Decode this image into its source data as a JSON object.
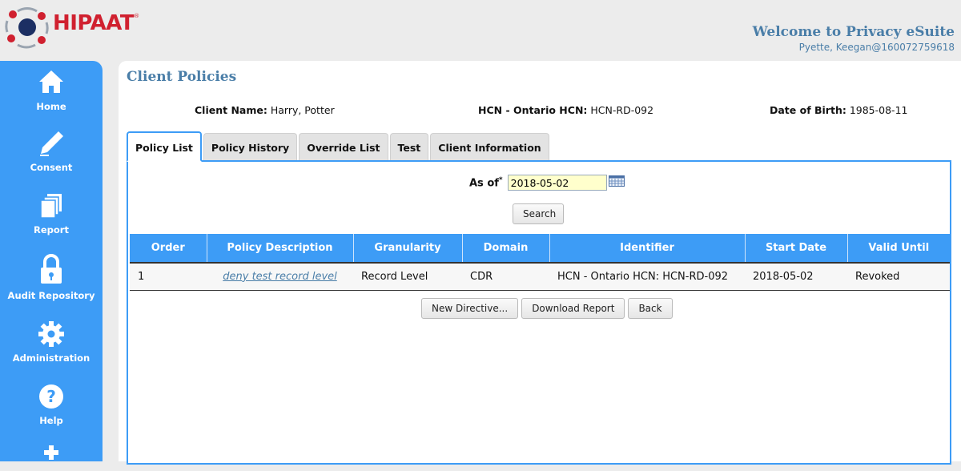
{
  "header": {
    "brand": "HIPAAT",
    "registered_mark": "®",
    "welcome": "Welcome to Privacy eSuite",
    "user": "Pyette, Keegan@160072759618"
  },
  "sidebar": {
    "items": [
      {
        "label": "Home",
        "icon": "home-icon"
      },
      {
        "label": "Consent",
        "icon": "pen-icon"
      },
      {
        "label": "Report",
        "icon": "documents-icon"
      },
      {
        "label": "Audit Repository",
        "icon": "lock-icon"
      },
      {
        "label": "Administration",
        "icon": "gear-icon"
      },
      {
        "label": "Help",
        "icon": "help-icon"
      }
    ]
  },
  "page": {
    "title": "Client Policies",
    "client_name_label": "Client Name:",
    "client_name": "Harry, Potter",
    "hcn_label": "HCN - Ontario HCN:",
    "hcn": "HCN-RD-092",
    "dob_label": "Date of Birth:",
    "dob": "1985-08-11"
  },
  "tabs": [
    {
      "label": "Policy List",
      "active": true
    },
    {
      "label": "Policy History",
      "active": false
    },
    {
      "label": "Override List",
      "active": false
    },
    {
      "label": "Test",
      "active": false
    },
    {
      "label": "Client Information",
      "active": false
    }
  ],
  "filter": {
    "as_of_label": "As of",
    "required_mark": "*",
    "as_of_value": "2018-05-02",
    "search_label": "Search"
  },
  "table": {
    "columns": [
      "Order",
      "Policy Description",
      "Granularity",
      "Domain",
      "Identifier",
      "Start Date",
      "Valid Until"
    ],
    "rows": [
      {
        "order": "1",
        "description": "deny test record level",
        "granularity": "Record Level",
        "domain": "CDR",
        "identifier": "HCN - Ontario HCN: HCN-RD-092",
        "start_date": "2018-05-02",
        "valid_until": "Revoked"
      }
    ]
  },
  "actions": {
    "new_directive": "New Directive...",
    "download_report": "Download Report",
    "back": "Back"
  },
  "colors": {
    "accent": "#3d9cf6",
    "title": "#4a7ea8",
    "brand_red": "#d0202f"
  }
}
